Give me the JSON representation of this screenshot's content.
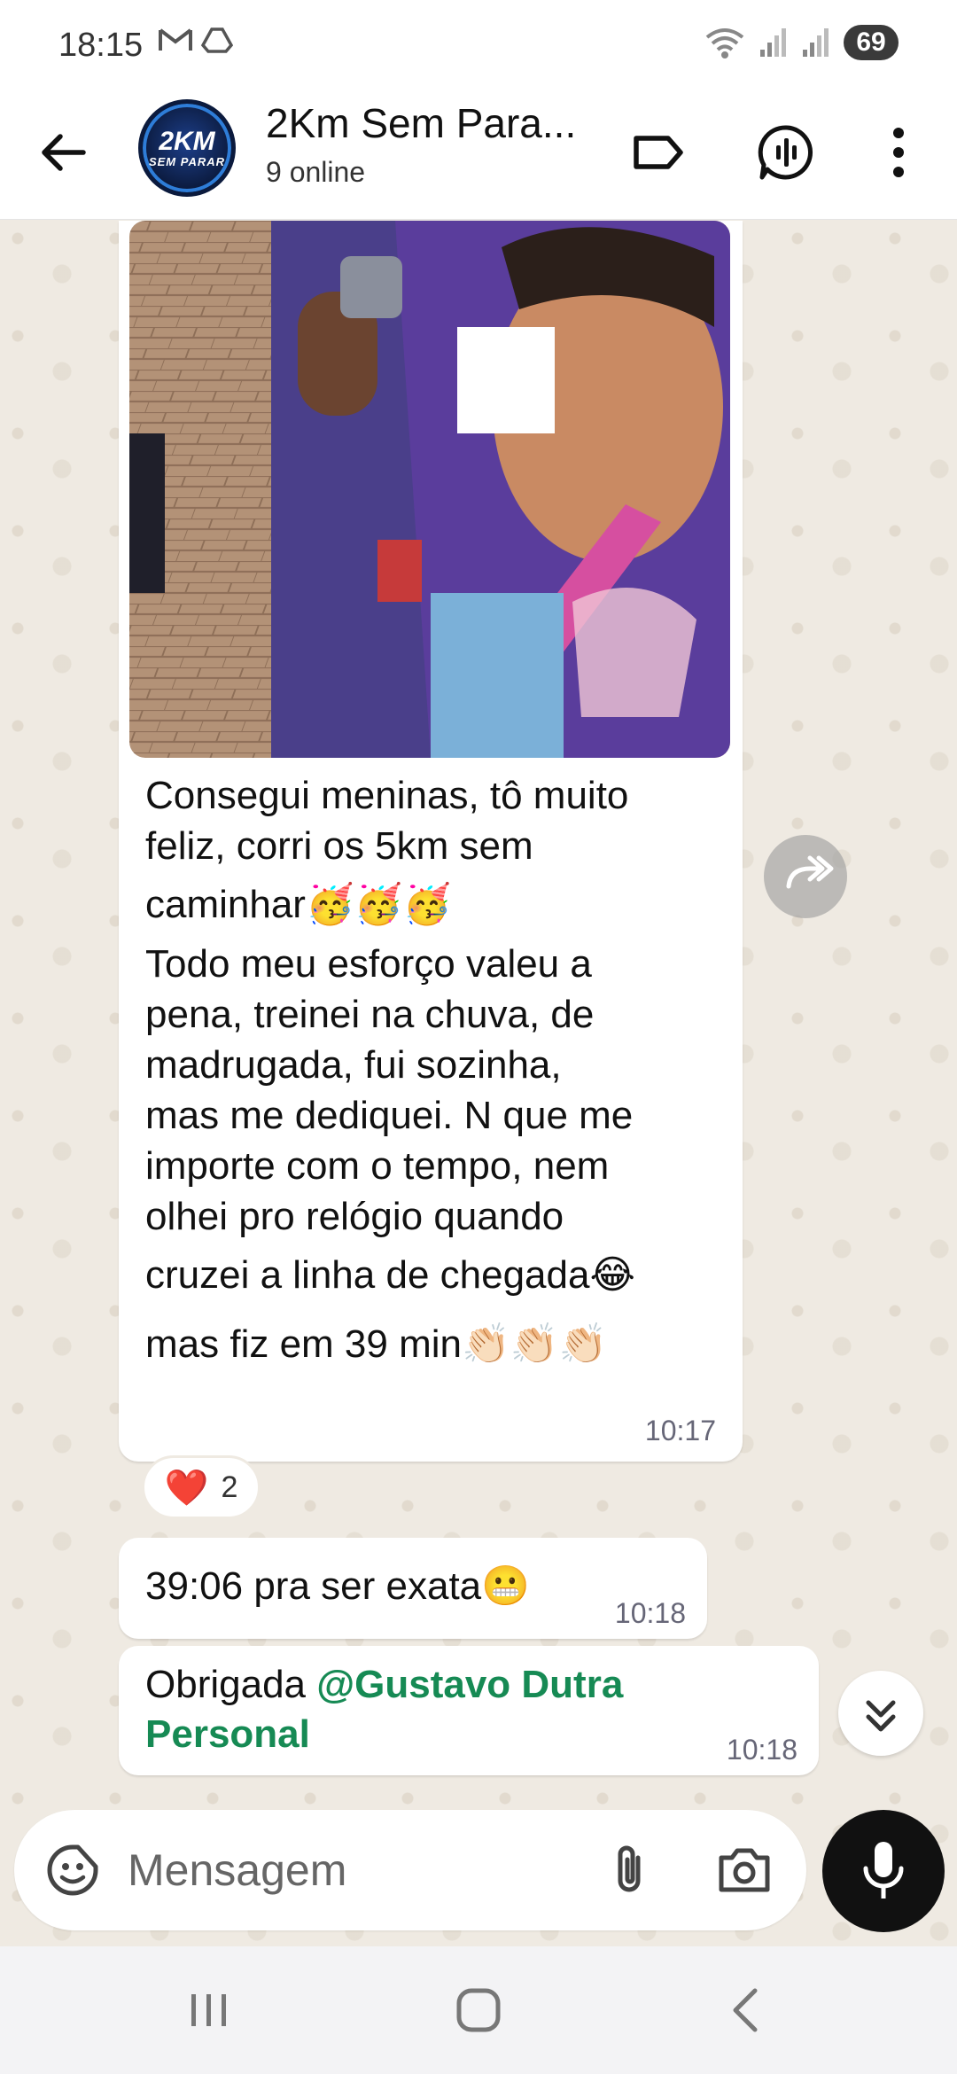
{
  "status_bar": {
    "time": "18:15",
    "notification_icons": [
      "gmail-icon",
      "drive-icon"
    ],
    "battery": "69"
  },
  "header": {
    "avatar_line1": "2KM",
    "avatar_line2": "SEM PARAR",
    "title": "2Km Sem Para...",
    "subtitle": "9 online"
  },
  "messages": [
    {
      "type": "image-caption",
      "lines": [
        "Consegui meninas, tô muito",
        "feliz, corri os 5km sem",
        "caminhar🥳🥳🥳",
        "Todo meu esforço valeu a",
        "pena, treinei na chuva, de",
        "madrugada, fui sozinha,",
        "mas me dediquei. N que me",
        "importe com o tempo, nem",
        "olhei pro relógio quando",
        "cruzei a linha de chegada😂",
        "mas fiz em 39 min👏🏻👏🏻👏🏻"
      ],
      "time": "10:17",
      "reaction": {
        "emoji": "❤️",
        "count": "2"
      }
    },
    {
      "type": "text",
      "text": "39:06 pra ser exata😬",
      "time": "10:18"
    },
    {
      "type": "text",
      "text_prefix": "Obrigada ",
      "mention_line1": "@Gustavo Dutra",
      "mention_line2": "Personal",
      "time": "10:18"
    }
  ],
  "composer": {
    "placeholder": "Mensagem"
  },
  "colors": {
    "mention": "#168a54",
    "wallpaper": "#efeae2",
    "mic_button": "#111111"
  }
}
